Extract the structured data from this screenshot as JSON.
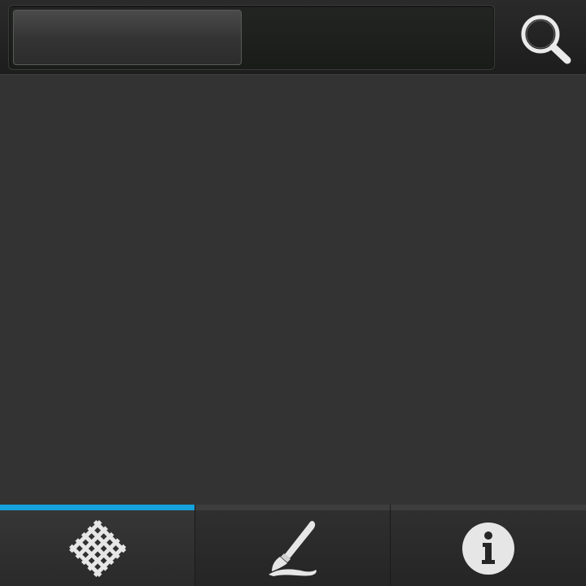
{
  "app": {
    "background": "#323232"
  },
  "toolbar": {
    "search_progress": 0.48,
    "search_icon": "search-icon"
  },
  "tabs": [
    {
      "id": "grid",
      "icon": "lattice-grid-icon",
      "active": true
    },
    {
      "id": "draw",
      "icon": "paintbrush-icon",
      "active": false
    },
    {
      "id": "info",
      "icon": "info-icon",
      "active": false
    }
  ],
  "colors": {
    "accent": "#16a2dd",
    "icon": "#e6e6e6"
  }
}
